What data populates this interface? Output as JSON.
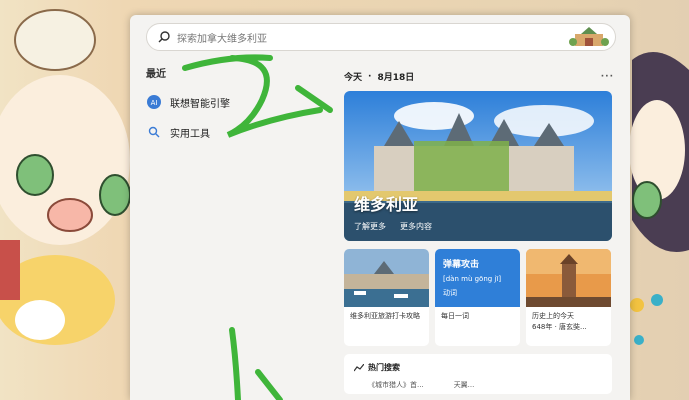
{
  "search": {
    "placeholder": "探索加拿大维多利亚"
  },
  "recent": {
    "header": "最近",
    "items": [
      {
        "label": "联想智能引擎",
        "icon": "lenovo-ai-icon"
      },
      {
        "label": "实用工具",
        "icon": "search-icon"
      }
    ]
  },
  "today": {
    "label": "今天",
    "date": "8月18日",
    "more": "···"
  },
  "hero": {
    "title": "维多利亚",
    "link1": "了解更多",
    "link2": "更多内容"
  },
  "cards": [
    {
      "caption": "维多利亚旅游打卡攻略"
    },
    {
      "title": "弹幕攻击",
      "pinyin": "[dàn mù gōng jī]",
      "pos": "动词",
      "caption": "每日一词"
    },
    {
      "caption": "历史上的今天",
      "subcaption": "648年 · 唐玄奘...",
      "subcaption_note": ""
    }
  ],
  "hot": {
    "header": "热门搜索",
    "items": [
      "《城市猎人》首...",
      "天翼..."
    ]
  },
  "colors": {
    "accent": "#2f7fd8",
    "panel": "#f4f3f1",
    "scribble": "#3fb53a"
  }
}
